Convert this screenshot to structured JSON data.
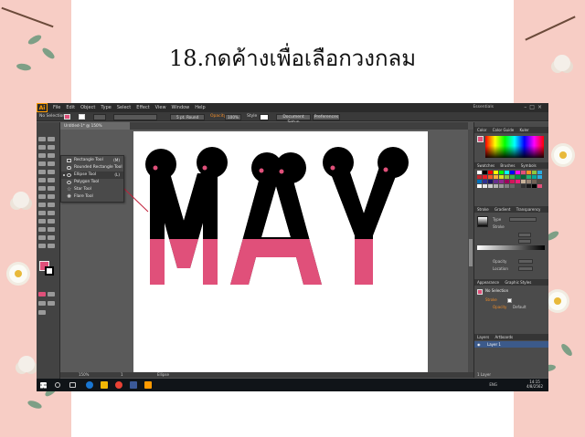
{
  "slide": {
    "title": "18.กดค้างเพื่อเลือกวงกลม"
  },
  "app": {
    "logo": "Ai",
    "menu": [
      "File",
      "Edit",
      "Object",
      "Type",
      "Select",
      "Effect",
      "View",
      "Window",
      "Help"
    ],
    "workspace": "Essentials",
    "window_controls": "–□×"
  },
  "control_bar": {
    "selection": "No Selection",
    "brush": "5 pt. Round",
    "opacity_label": "Opacity",
    "opacity_value": "100%",
    "style_label": "Style",
    "document_setup": "Document Setup",
    "preferences": "Preferences"
  },
  "document_tab": "Untitled-1* @ 150% (CMYK/Preview)",
  "tool_flyout": {
    "items": [
      {
        "label": "Rectangle Tool",
        "shortcut": "(M)",
        "icon": "rectangle-icon"
      },
      {
        "label": "Rounded Rectangle Tool",
        "shortcut": "",
        "icon": "rounded-rectangle-icon"
      },
      {
        "label": "Ellipse Tool",
        "shortcut": "(L)",
        "icon": "ellipse-icon"
      },
      {
        "label": "Polygon Tool",
        "shortcut": "",
        "icon": "polygon-icon"
      },
      {
        "label": "Star Tool",
        "shortcut": "",
        "icon": "star-icon"
      },
      {
        "label": "Flare Tool",
        "shortcut": "",
        "icon": "flare-icon"
      }
    ]
  },
  "artwork": {
    "letters": "MAY",
    "top_color": "#000000",
    "bottom_color": "#e0507a"
  },
  "status_bar": {
    "zoom": "150%",
    "page": "1",
    "tool": "Ellipse"
  },
  "panels": {
    "color_tabs": [
      "Color",
      "Color Guide",
      "Kuler"
    ],
    "swatch_tabs": [
      "Swatches",
      "Brushes",
      "Symbols"
    ],
    "gradient_tabs": [
      "Stroke",
      "Gradient",
      "Transparency"
    ],
    "gradient": {
      "type_label": "Type",
      "stroke_label": "Stroke",
      "opacity_label": "Opacity",
      "location_label": "Location"
    },
    "appearance_tabs": [
      "Appearance",
      "Graphic Styles"
    ],
    "appearance": {
      "selection": "No Selection",
      "stroke_label": "Stroke",
      "opacity_label": "Opacity",
      "opacity_value": "Default"
    },
    "layers_tabs": [
      "Layers",
      "Artboards"
    ],
    "layer_name": "Layer 1",
    "layer_count": "1 Layer"
  },
  "taskbar": {
    "time": "14:15",
    "date": "4/8/2562",
    "language": "ENG"
  },
  "colors": {
    "accent_pink": "#e0507a",
    "annotation_line": "#c0203a"
  }
}
